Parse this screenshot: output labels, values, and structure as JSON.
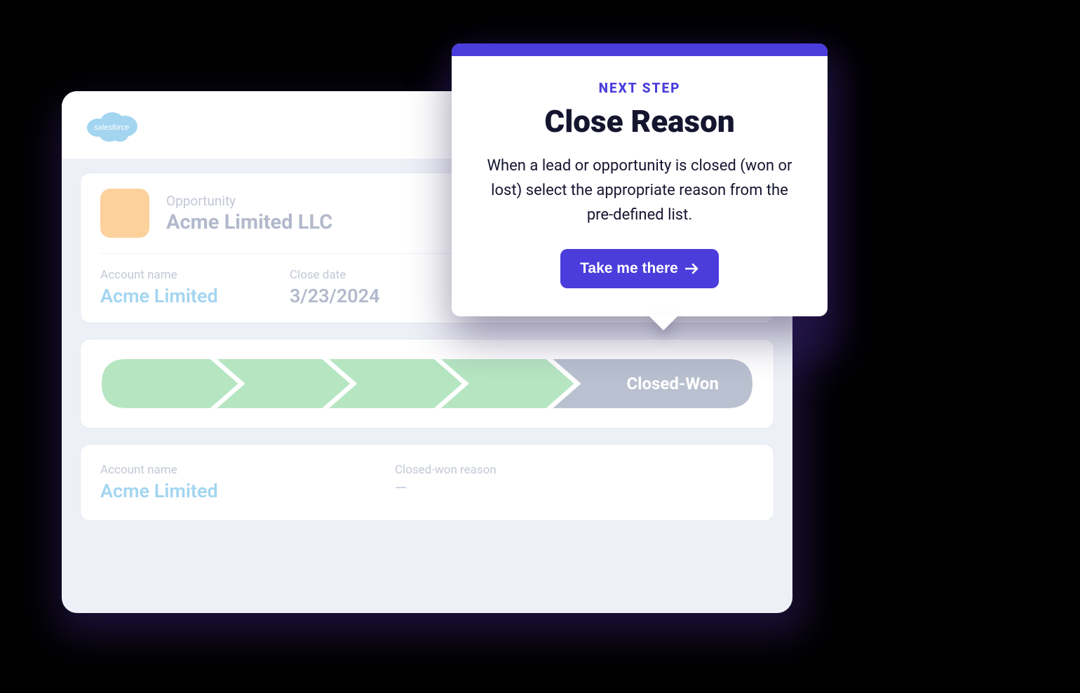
{
  "app": {
    "logo_name": "salesforce"
  },
  "opportunity": {
    "subtitle": "Opportunity",
    "title": "Acme Limited LLC"
  },
  "fields_top": {
    "account_name_label": "Account name",
    "account_name_value": "Acme Limited",
    "close_date_label": "Close date",
    "close_date_value": "3/23/2024"
  },
  "stage_path": {
    "final_stage": "Closed-Won"
  },
  "fields_bottom": {
    "account_name_label": "Account name",
    "account_name_value": "Acme Limited",
    "closed_reason_label": "Closed-won reason",
    "closed_reason_value": "—"
  },
  "callout": {
    "eyebrow": "NEXT STEP",
    "title": "Close Reason",
    "description": "When a lead or opportunity is closed (won or lost) select the appropriate reason from the pre-defined list.",
    "cta_label": "Take me there"
  },
  "colors": {
    "accent": "#4a3ddb",
    "stage_green": "#b6e5c2",
    "stage_gray": "#b9c1d0"
  }
}
